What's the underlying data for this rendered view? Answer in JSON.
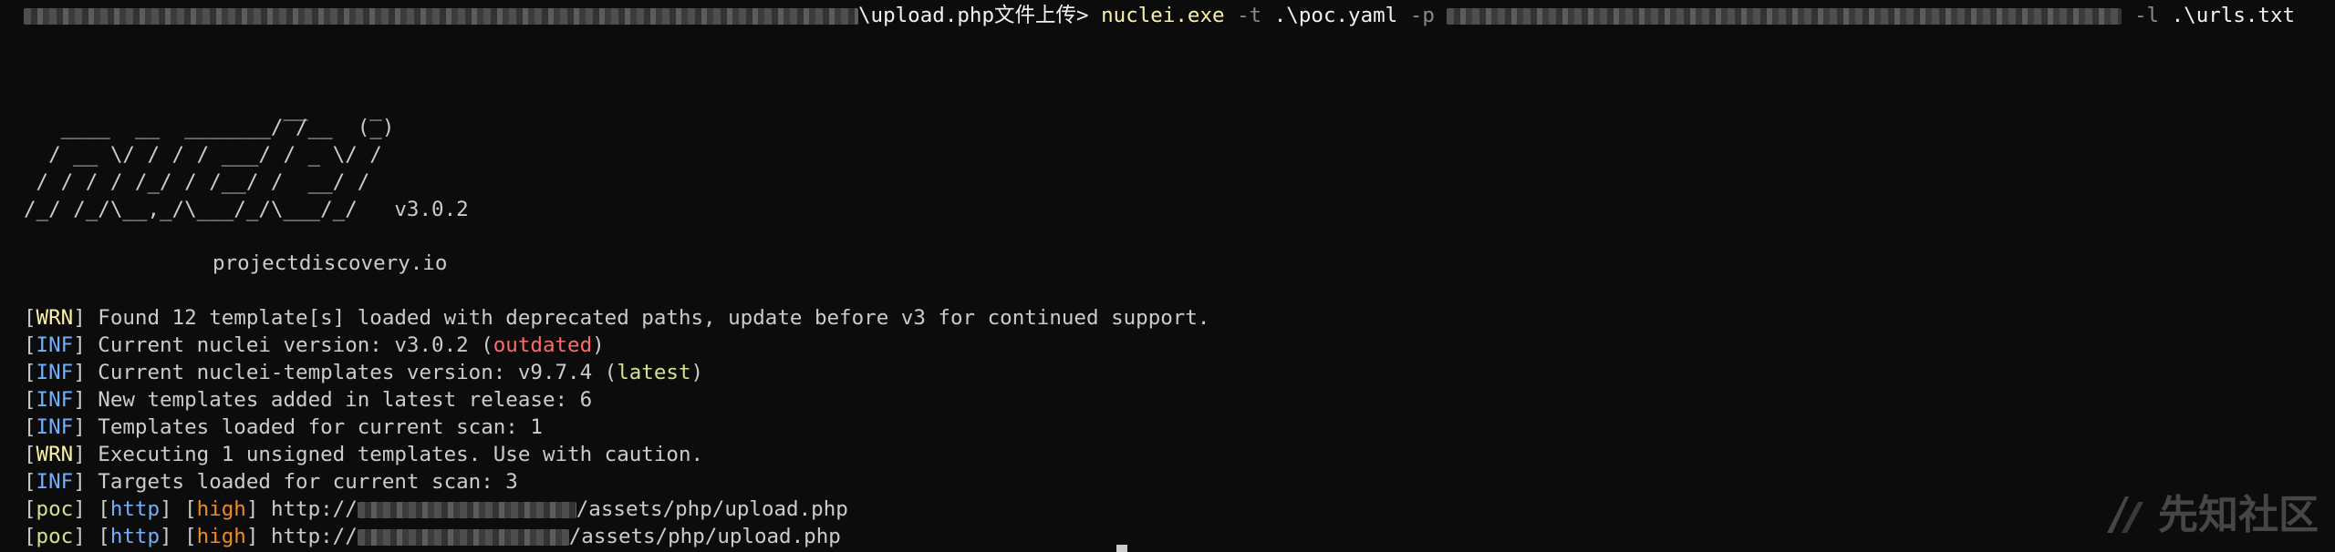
{
  "command": {
    "path_visible": "\\upload.php文件上传>",
    "executable": "nuclei.exe",
    "flag_t": "-t",
    "template_arg": ".\\poc.yaml",
    "flag_p": "-p",
    "flag_l": "-l",
    "list_arg": ".\\urls.txt"
  },
  "banner": {
    "logo_lines": [
      "                     __     _",
      "   ____  __  _______/ /__  (_)",
      "  / __ \\/ / / / ___/ / _ \\/ /",
      " / / / / /_/ / /__/ /  __/ /",
      "/_/ /_/\\__,_/\\___/_/\\___/_/   v3.0.2"
    ],
    "site": "projectdiscovery.io"
  },
  "log": [
    {
      "tag": "WRN",
      "text": " Found 12 template[s] loaded with deprecated paths, update before v3 for continued support."
    },
    {
      "tag": "INF",
      "text": " Current nuclei version: v3.0.2 (",
      "highlight": "outdated",
      "highlight_color": "red",
      "suffix": ")"
    },
    {
      "tag": "INF",
      "text": " Current nuclei-templates version: v9.7.4 (",
      "highlight": "latest",
      "highlight_color": "green",
      "suffix": ")"
    },
    {
      "tag": "INF",
      "text": " New templates added in latest release: 6"
    },
    {
      "tag": "INF",
      "text": " Templates loaded for current scan: 1"
    },
    {
      "tag": "WRN",
      "text": " Executing 1 unsigned templates. Use with caution."
    },
    {
      "tag": "INF",
      "text": " Targets loaded for current scan: 3"
    }
  ],
  "results": [
    {
      "template": "poc",
      "protocol": "http",
      "severity": "high",
      "url_prefix": "http://",
      "url_suffix": "/assets/php/upload.php"
    },
    {
      "template": "poc",
      "protocol": "http",
      "severity": "high",
      "url_prefix": "http://",
      "url_suffix": "/assets/php/upload.php"
    }
  ],
  "watermark": "先知社区",
  "icons": {
    "watermark": "xianzhi-logo-icon"
  },
  "colors": {
    "background": "#0c0c0c",
    "text": "#cccccc",
    "warn": "#f9f1a5",
    "info": "#6fb0ff",
    "outdated": "#ff6a6a",
    "high": "#f08a24",
    "latest": "#d8e08a"
  }
}
